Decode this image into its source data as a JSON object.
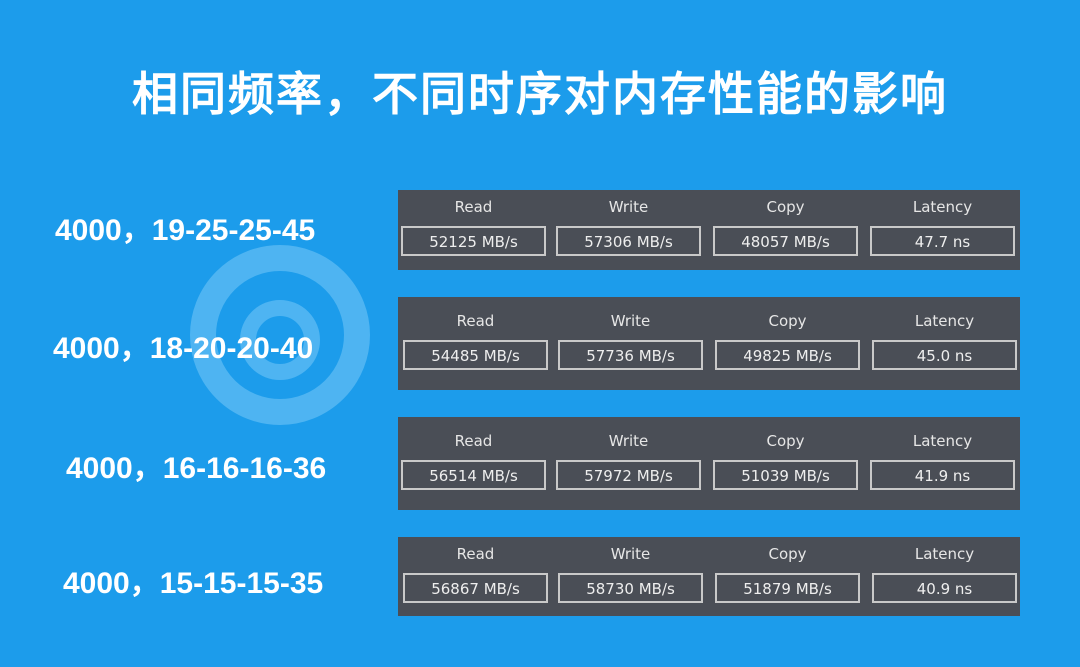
{
  "title": "相同频率，不同时序对内存性能的影响",
  "headers": [
    "Read",
    "Write",
    "Copy",
    "Latency"
  ],
  "rows": [
    {
      "label": "4000，19-25-25-45",
      "values": [
        "52125 MB/s",
        "57306 MB/s",
        "48057 MB/s",
        "47.7 ns"
      ]
    },
    {
      "label": "4000，18-20-20-40",
      "values": [
        "54485 MB/s",
        "57736 MB/s",
        "49825 MB/s",
        "45.0 ns"
      ]
    },
    {
      "label": "4000，16-16-16-36",
      "values": [
        "56514 MB/s",
        "57972 MB/s",
        "51039 MB/s",
        "41.9 ns"
      ]
    },
    {
      "label": "4000，15-15-15-35",
      "values": [
        "56867 MB/s",
        "58730 MB/s",
        "51879 MB/s",
        "40.9 ns"
      ]
    }
  ]
}
